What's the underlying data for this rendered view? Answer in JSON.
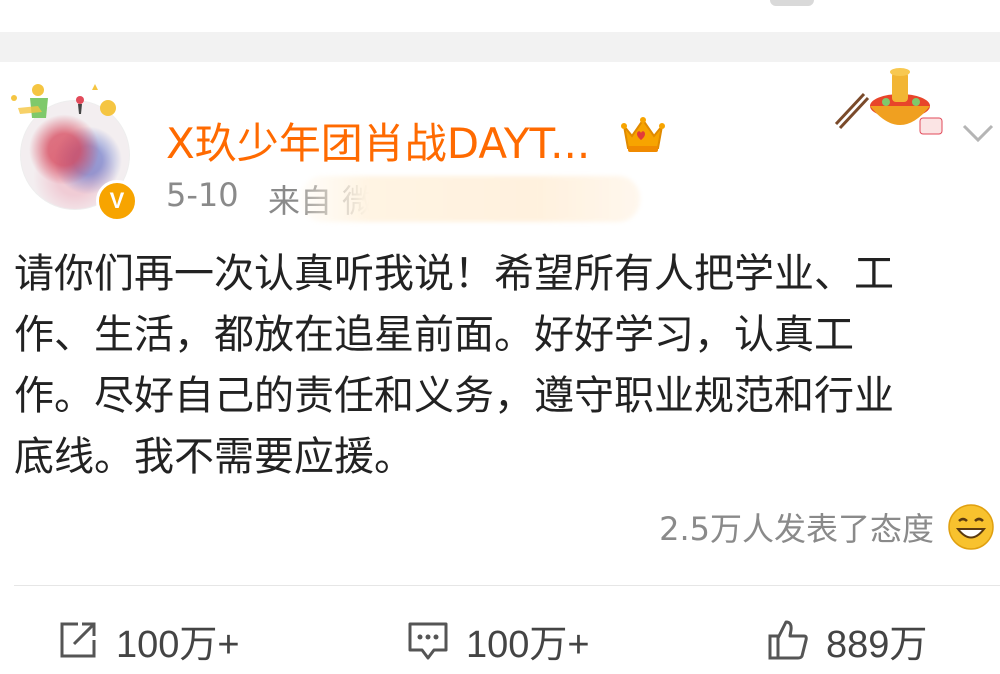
{
  "post": {
    "username": "X玖少年团肖战DAYT...",
    "date": "5-10",
    "source_prefix": "来自 微博",
    "verified_badge": "V",
    "content_lines": [
      "请你们再一次认真听我说！希望所有人把学业、工",
      "作、生活，都放在追星前面。好好学习，认真工",
      "作。尽好自己的责任和义务，遵守职业规范和行业",
      "底线。我不需要应援。"
    ],
    "reaction_text": "2.5万人发表了态度"
  },
  "actions": {
    "share_count": "100万+",
    "comment_count": "100万+",
    "like_count": "889万"
  },
  "colors": {
    "username": "#ff6a00",
    "meta": "#8a8a8a",
    "separator": "#f2f2f2",
    "badge": "#f7a400"
  },
  "icons": [
    "crown-icon",
    "hotpot-sticker-icon",
    "chevron-down-icon",
    "smile-emoji-icon",
    "share-icon",
    "comment-icon",
    "like-icon",
    "verified-v-icon"
  ]
}
